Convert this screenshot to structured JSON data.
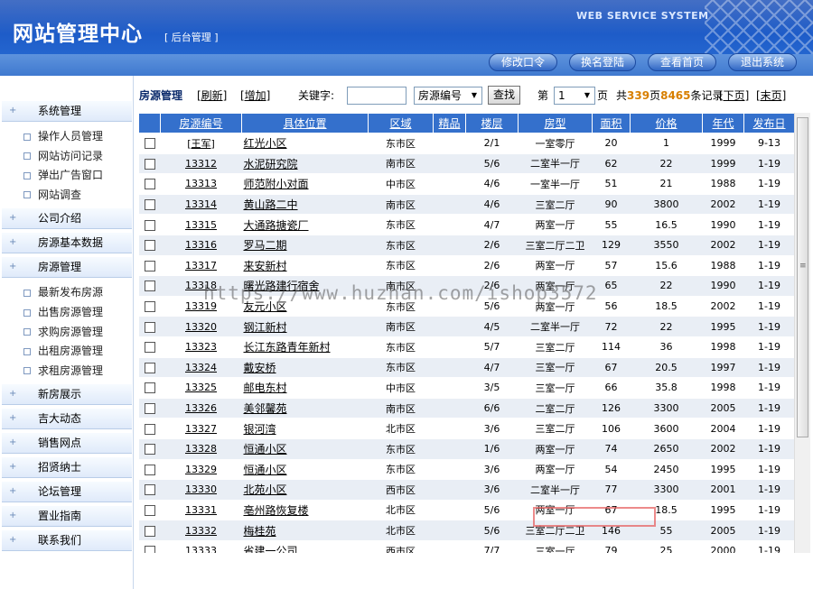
{
  "header": {
    "title": "网站管理中心",
    "subtitle": "[ 后台管理 ]",
    "system_label": "WEB SERVICE SYSTEM",
    "buttons": [
      "修改口令",
      "换名登陆",
      "查看首页",
      "退出系统"
    ]
  },
  "sidebar": {
    "groups": [
      {
        "label": "系统管理",
        "items": [
          "操作人员管理",
          "网站访问记录",
          "弹出广告窗口",
          "网站调查"
        ]
      },
      {
        "label": "公司介绍",
        "items": []
      },
      {
        "label": "房源基本数据",
        "items": []
      },
      {
        "label": "房源管理",
        "items": [
          "最新发布房源",
          "出售房源管理",
          "求购房源管理",
          "出租房源管理",
          "求租房源管理"
        ]
      },
      {
        "label": "新房展示",
        "items": []
      },
      {
        "label": "吉大动态",
        "items": []
      },
      {
        "label": "销售网点",
        "items": []
      },
      {
        "label": "招贤纳士",
        "items": []
      },
      {
        "label": "论坛管理",
        "items": []
      },
      {
        "label": "置业指南",
        "items": []
      },
      {
        "label": "联系我们",
        "items": []
      }
    ]
  },
  "toolbar": {
    "section_title": "房源管理",
    "refresh_link": "[刷新]",
    "add_link": "[增加]",
    "keyword_label": "关键字:",
    "keyword_value": "",
    "field_select": "房源编号",
    "search_button": "查找",
    "page_prefix": "第",
    "page_select": "1",
    "page_suffix": "页",
    "total_prefix": "共",
    "total_pages": "339",
    "pages_word": "页",
    "total_records": "8465",
    "records_word": "条记录",
    "next_page": "[下页]",
    "last_page": "[末页]"
  },
  "table": {
    "columns": [
      "",
      "房源编号",
      "具体位置",
      "区域",
      "精品",
      "楼层",
      "房型",
      "面积",
      "价格",
      "年代",
      "发布日"
    ],
    "rows": [
      [
        "[王军]",
        "红光小区",
        "东市区",
        "",
        "2/1",
        "一室零厅",
        "20",
        "1",
        "1999",
        "9-13"
      ],
      [
        "13312",
        "水泥研究院",
        "南市区",
        "",
        "5/6",
        "二室半一厅",
        "62",
        "22",
        "1999",
        "1-19"
      ],
      [
        "13313",
        "师范附小对面",
        "中市区",
        "",
        "4/6",
        "一室半一厅",
        "51",
        "21",
        "1988",
        "1-19"
      ],
      [
        "13314",
        "黄山路二中",
        "南市区",
        "",
        "4/6",
        "三室二厅",
        "90",
        "3800",
        "2002",
        "1-19"
      ],
      [
        "13315",
        "大通路搪瓷厂",
        "东市区",
        "",
        "4/7",
        "两室一厅",
        "55",
        "16.5",
        "1990",
        "1-19"
      ],
      [
        "13316",
        "罗马二期",
        "东市区",
        "",
        "2/6",
        "三室二厅二卫",
        "129",
        "3550",
        "2002",
        "1-19"
      ],
      [
        "13317",
        "来安新村",
        "东市区",
        "",
        "2/6",
        "两室一厅",
        "57",
        "15.6",
        "1988",
        "1-19"
      ],
      [
        "13318",
        "曙光路建行宿舍",
        "南市区",
        "",
        "2/6",
        "两室一厅",
        "65",
        "22",
        "1990",
        "1-19"
      ],
      [
        "13319",
        "友元小区",
        "东市区",
        "",
        "5/6",
        "两室一厅",
        "56",
        "18.5",
        "2002",
        "1-19"
      ],
      [
        "13320",
        "钢江新村",
        "南市区",
        "",
        "4/5",
        "二室半一厅",
        "72",
        "22",
        "1995",
        "1-19"
      ],
      [
        "13323",
        "长江东路青年新村",
        "东市区",
        "",
        "5/7",
        "三室二厅",
        "114",
        "36",
        "1998",
        "1-19"
      ],
      [
        "13324",
        "戴安桥",
        "东市区",
        "",
        "4/7",
        "三室一厅",
        "67",
        "20.5",
        "1997",
        "1-19"
      ],
      [
        "13325",
        "邮电东村",
        "中市区",
        "",
        "3/5",
        "三室一厅",
        "66",
        "35.8",
        "1998",
        "1-19"
      ],
      [
        "13326",
        "美邻馨苑",
        "南市区",
        "",
        "6/6",
        "二室二厅",
        "126",
        "3300",
        "2005",
        "1-19"
      ],
      [
        "13327",
        "银河湾",
        "北市区",
        "",
        "3/6",
        "三室二厅",
        "106",
        "3600",
        "2004",
        "1-19"
      ],
      [
        "13328",
        "恒通小区",
        "东市区",
        "",
        "1/6",
        "两室一厅",
        "74",
        "2650",
        "2002",
        "1-19"
      ],
      [
        "13329",
        "恒通小区",
        "东市区",
        "",
        "3/6",
        "两室一厅",
        "54",
        "2450",
        "1995",
        "1-19"
      ],
      [
        "13330",
        "北苑小区",
        "西市区",
        "",
        "3/6",
        "二室半一厅",
        "77",
        "3300",
        "2001",
        "1-19"
      ],
      [
        "13331",
        "亳州路恢复楼",
        "北市区",
        "",
        "5/6",
        "两室一厅",
        "67",
        "18.5",
        "1995",
        "1-19"
      ],
      [
        "13332",
        "梅桂苑",
        "北市区",
        "",
        "5/6",
        "三室二厅二卫",
        "146",
        "55",
        "2005",
        "1-19"
      ],
      [
        "13333",
        "省建一公司",
        "西市区",
        "",
        "7/7",
        "三室一厅",
        "79",
        "25",
        "2000",
        "1-19"
      ]
    ]
  },
  "watermark": "https://www.huzhan.com/ishop3572"
}
